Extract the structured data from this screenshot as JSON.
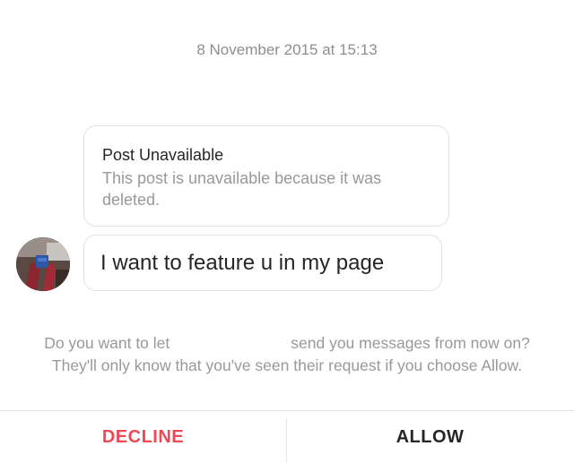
{
  "thread": {
    "timestamp": "8 November 2015 at 15:13"
  },
  "shared_post": {
    "title": "Post Unavailable",
    "description": "This post is unavailable because it was deleted."
  },
  "message": {
    "text": "I want to feature u in my page"
  },
  "request": {
    "prompt_before": "Do you want to let",
    "prompt_after": "send you messages from now on?",
    "note": "They'll only know that you've seen their request if you choose Allow."
  },
  "actions": {
    "decline_label": "DECLINE",
    "allow_label": "ALLOW"
  },
  "colors": {
    "decline": "#ed4956",
    "text": "#262626",
    "muted": "#999999"
  }
}
